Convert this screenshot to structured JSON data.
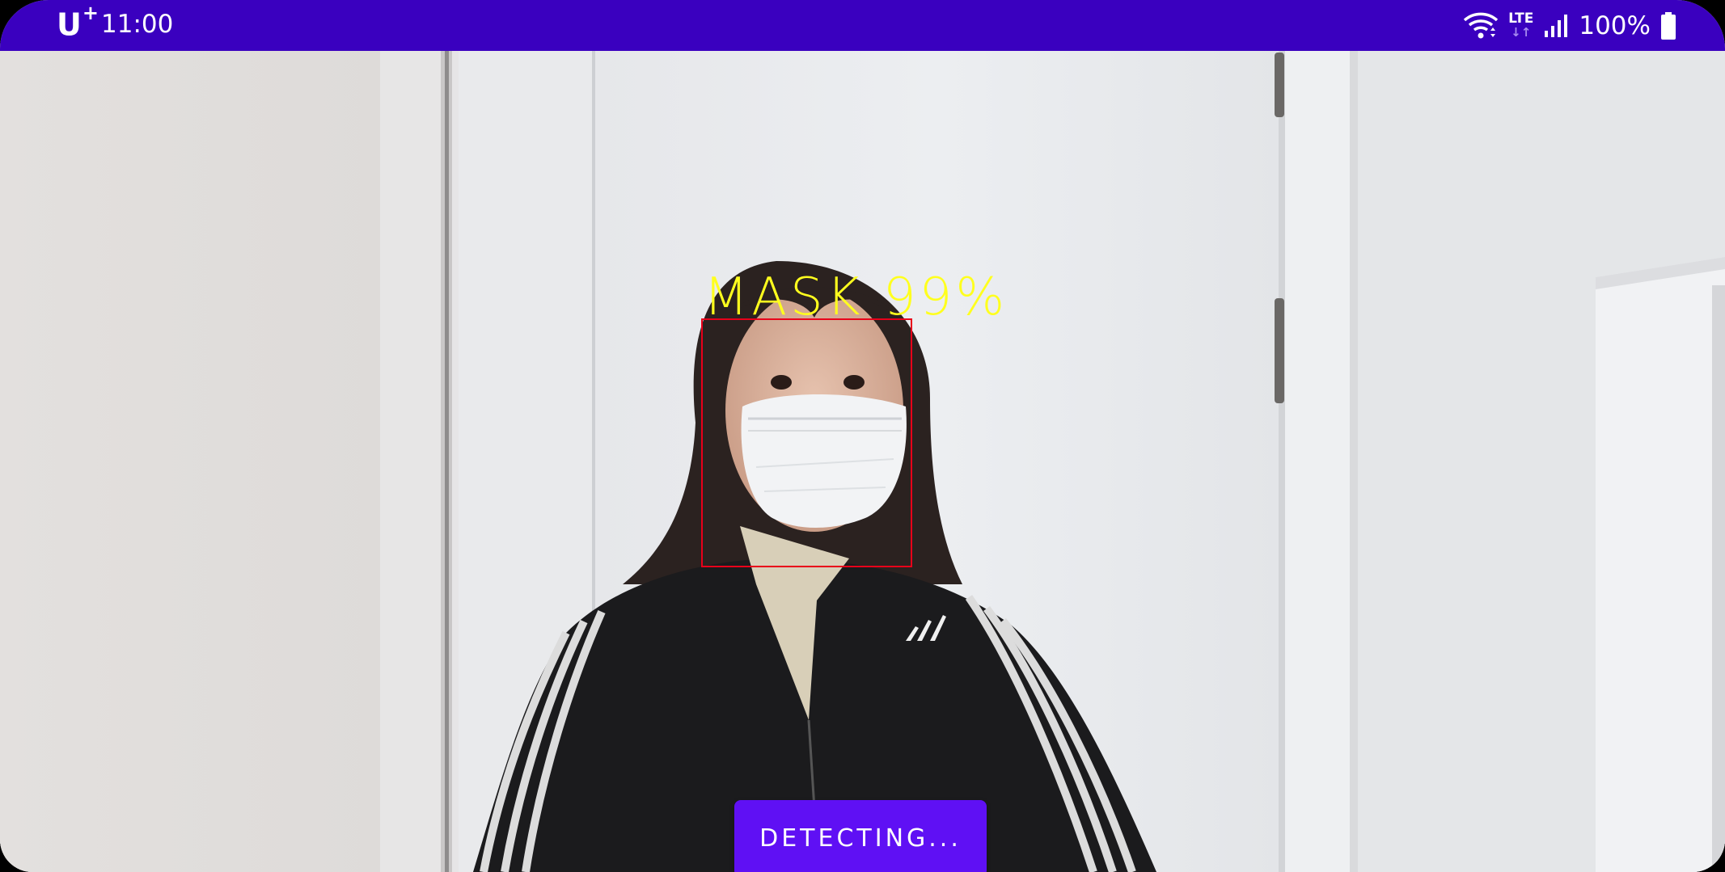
{
  "status_bar": {
    "carrier": "U",
    "carrier_plus": "+",
    "time": "11:00",
    "network_type": "LTE",
    "battery_percent": "100%",
    "wifi_icon": "wifi-icon",
    "signal_icon": "cell-signal-icon",
    "battery_icon": "battery-full-icon",
    "colors": {
      "background": "#3a00bf",
      "text": "#ffffff"
    }
  },
  "detection": {
    "label": "MASK 99%",
    "label_color": "#ffff1e",
    "box_color": "#e8001a"
  },
  "action_button": {
    "label": "DETECTING...",
    "color": "#5f10f4"
  }
}
